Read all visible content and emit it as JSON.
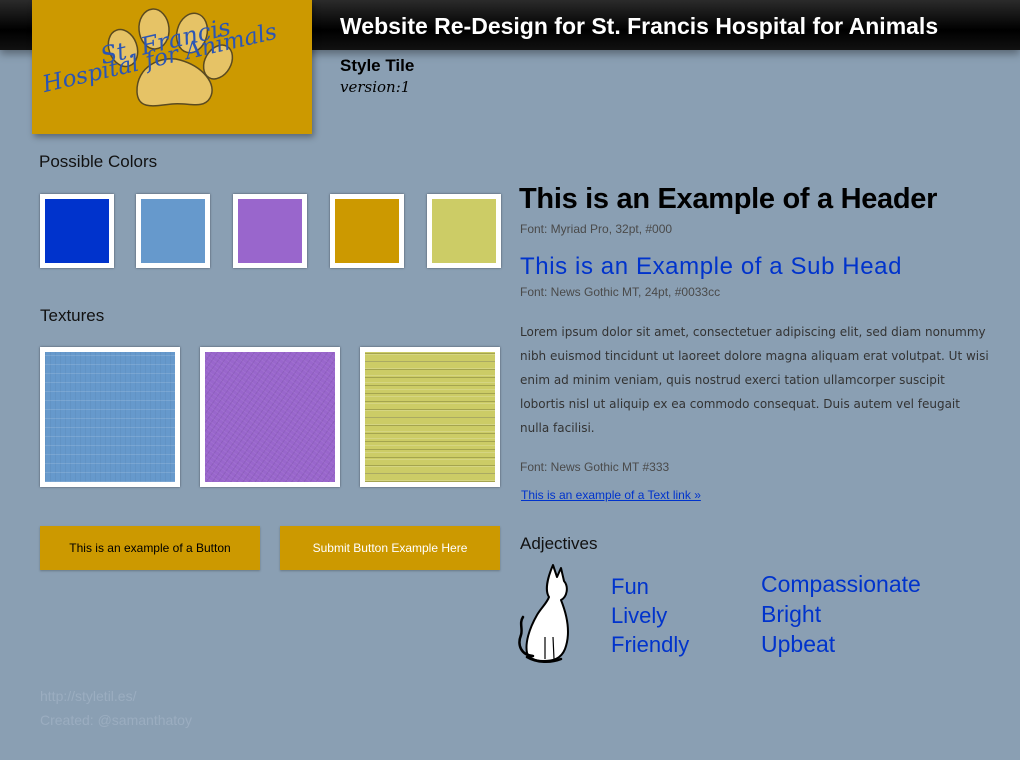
{
  "header": {
    "title": "Website Re-Design for St. Francis Hospital for Animals",
    "style_tile": "Style Tile",
    "version": "version:1"
  },
  "logo": {
    "line1": "St. Francis",
    "line2": "Hospital for Animals",
    "background": "#cc9900",
    "paw_color": "#e6c366",
    "text_color": "#2a55b5"
  },
  "colors_section": {
    "label": "Possible Colors",
    "swatches": [
      "#0033cc",
      "#6699cc",
      "#9966cc",
      "#cc9900",
      "#cccc66"
    ]
  },
  "textures_section": {
    "label": "Textures",
    "items": [
      "blue-lined",
      "purple-grain",
      "yellow-lined"
    ]
  },
  "buttons": {
    "example": "This is an example of a Button",
    "submit": "Submit Button Example Here"
  },
  "typography": {
    "header_example": "This is an Example of a Header",
    "header_note": "Font: Myriad Pro, 32pt, #000",
    "subhead_example": "This is an Example of a Sub Head",
    "subhead_note": "Font: News Gothic MT, 24pt, #0033cc",
    "body_text": "Lorem ipsum dolor sit amet, consectetuer adipiscing elit, sed diam nonummy nibh euismod tincidunt ut laoreet dolore magna aliquam erat volutpat. Ut wisi enim ad minim veniam, quis nostrud exerci tation ullamcorper suscipit lobortis nisl ut aliquip ex ea commodo consequat. Duis autem vel feugait nulla facilisi.",
    "body_note": "Font: News Gothic MT #333",
    "link_text": "This is an example of a Text link »"
  },
  "adjectives": {
    "label": "Adjectives",
    "column1": [
      "Fun",
      "Lively",
      "Friendly"
    ],
    "column2": [
      "Compassionate",
      "Bright",
      "Upbeat"
    ]
  },
  "footer": {
    "line1": "http://styletil.es/",
    "line2": "Created: @samanthatoy"
  }
}
